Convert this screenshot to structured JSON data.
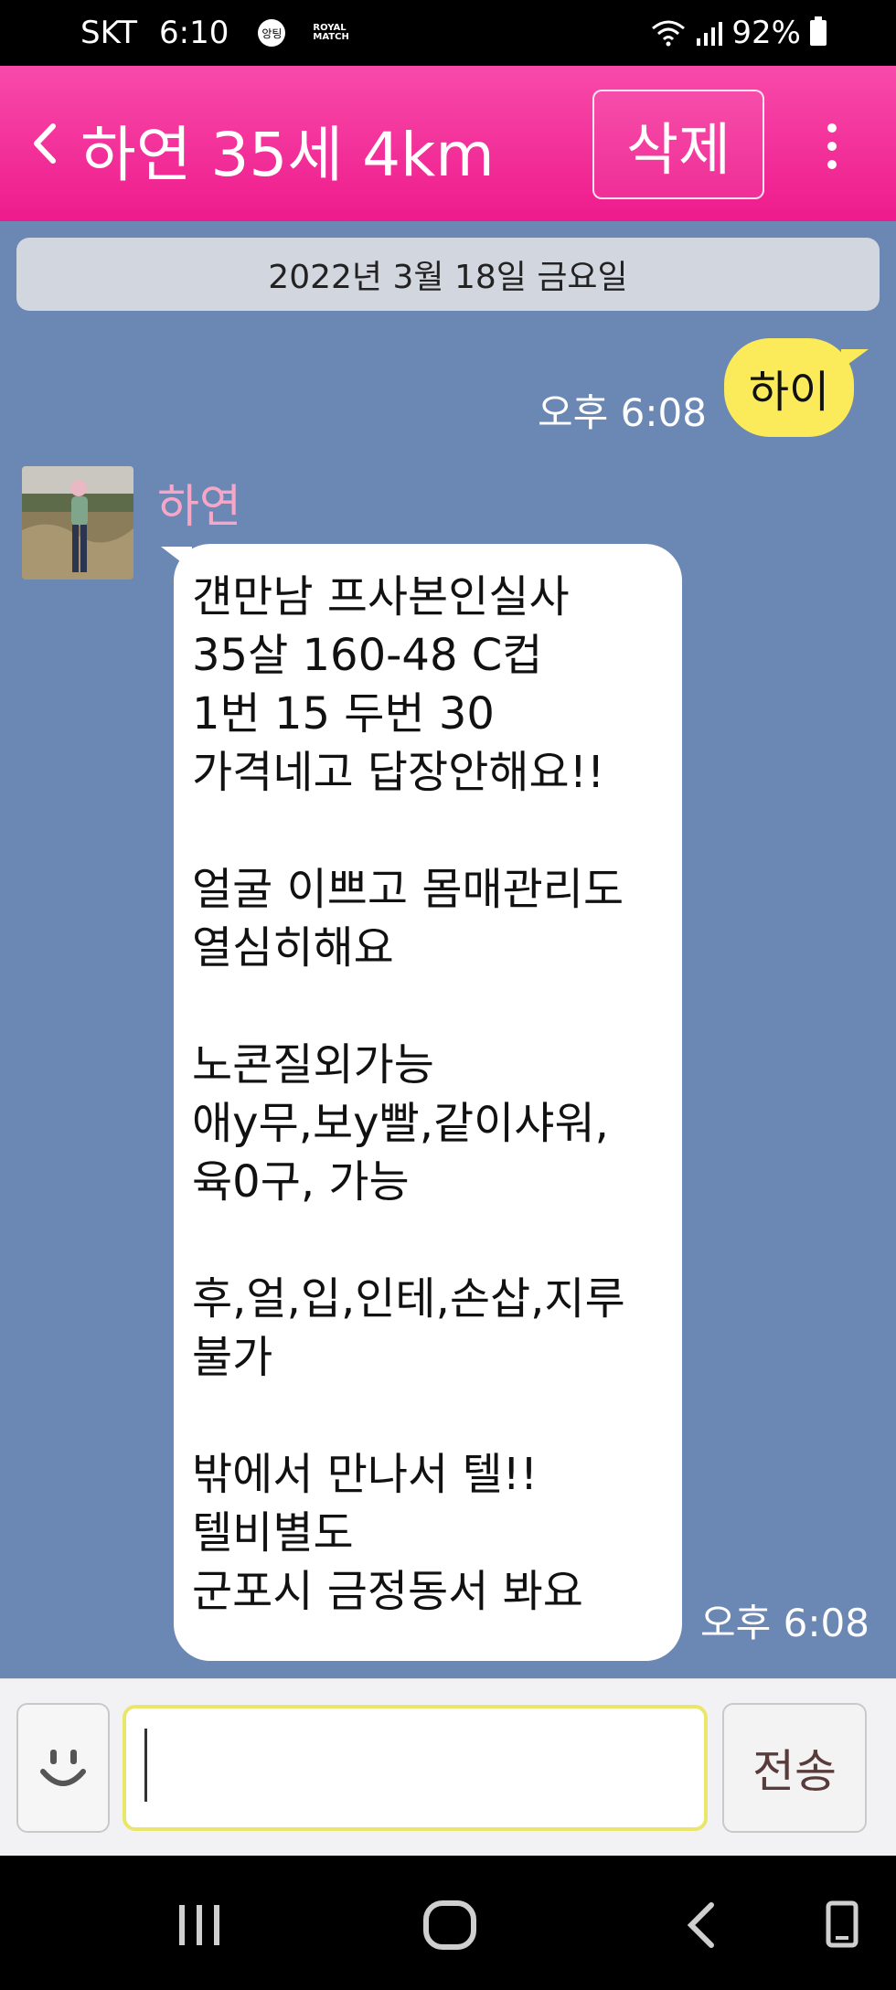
{
  "status_bar": {
    "carrier": "SKT",
    "time": "6:10",
    "badge": "앙팅",
    "app_badge": "ROYAL MATCH",
    "battery": "92%"
  },
  "header": {
    "title": "하연 35세 4km",
    "delete_label": "삭제"
  },
  "chat": {
    "date": "2022년 3월 18일 금요일",
    "outgoing": {
      "text": "하이",
      "time": "오후 6:08"
    },
    "incoming": {
      "sender": "하연",
      "time": "오후 6:08",
      "lines": [
        "걘만남 프사본인실사",
        "35살 160-48 C컵",
        "1번 15 두번 30",
        "가격네고 답장안해요!!",
        "",
        "얼굴 이쁘고 몸매관리도",
        "열심히해요",
        "",
        "노콘질외가능",
        "애y무,보y빨,같이샤워,",
        "육0구, 가능",
        "",
        "후,얼,입,인테,손삽,지루",
        "불가",
        "",
        "밖에서 만나서 텔!!",
        "텔비별도",
        "군포시 금정동서 봐요"
      ]
    }
  },
  "input": {
    "value": "",
    "send_label": "전송"
  },
  "colors": {
    "header_pink": "#ee1b8c",
    "chat_bg": "#6b87b4",
    "outgoing_bubble": "#fbea59",
    "sender_name": "#f7a6c8"
  },
  "icons": [
    "back-icon",
    "more-icon",
    "emoji-icon",
    "wifi-icon",
    "signal-icon",
    "battery-icon",
    "recent-apps-icon",
    "home-icon",
    "nav-back-icon",
    "rotate-icon"
  ]
}
